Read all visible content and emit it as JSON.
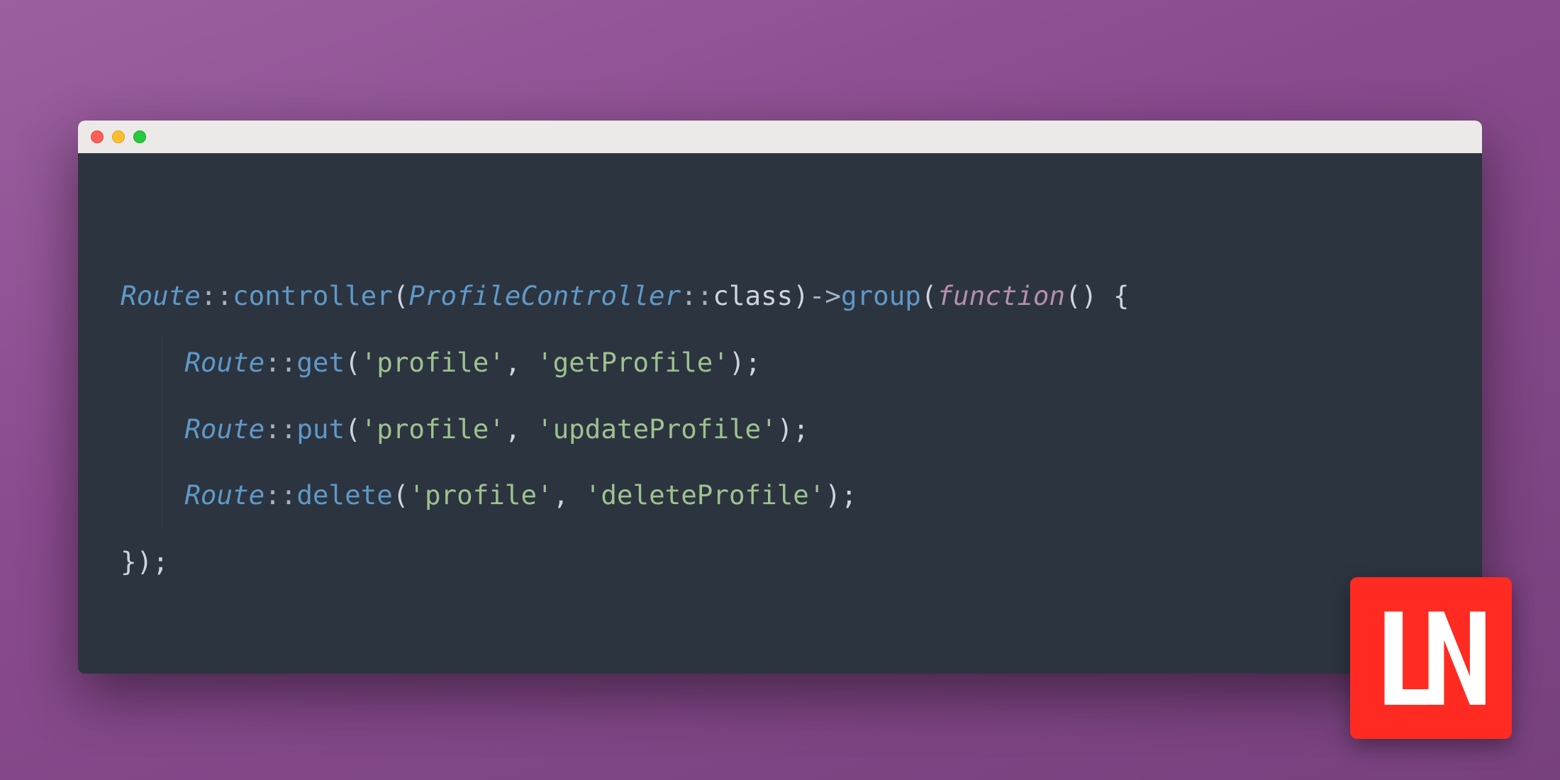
{
  "colors": {
    "background_from": "#9b5f9f",
    "background_to": "#77417d",
    "editor_bg": "#2c3440",
    "titlebar_bg": "#eceae8",
    "dot_red": "#ff5f56",
    "dot_yellow": "#ffbd2e",
    "dot_green": "#27c93f",
    "token_class": "#5f99c7",
    "token_method": "#5f99c7",
    "token_string": "#9ec28f",
    "token_fnkw": "#b48ead",
    "token_plain": "#cfd4e0",
    "token_scope": "#a6b2c1",
    "logo_bg": "#ff2b22"
  },
  "window_controls": {
    "close": "close-icon",
    "minimize": "minimize-icon",
    "zoom": "zoom-icon"
  },
  "logo": {
    "name": "LN",
    "semantic": "laravel-news-logo"
  },
  "code": {
    "language": "php",
    "lines": [
      {
        "indent": 0,
        "tokens": [
          {
            "t": "class",
            "v": "Route"
          },
          {
            "t": "scope",
            "v": "::"
          },
          {
            "t": "method",
            "v": "controller"
          },
          {
            "t": "paren",
            "v": "("
          },
          {
            "t": "class",
            "v": "ProfileController"
          },
          {
            "t": "scope",
            "v": "::"
          },
          {
            "t": "kwclass",
            "v": "class"
          },
          {
            "t": "paren",
            "v": ")"
          },
          {
            "t": "arrow",
            "v": "->"
          },
          {
            "t": "method",
            "v": "group"
          },
          {
            "t": "paren",
            "v": "("
          },
          {
            "t": "fnkw",
            "v": "function"
          },
          {
            "t": "paren",
            "v": "()"
          },
          {
            "t": "plain",
            "v": " {"
          }
        ]
      },
      {
        "indent": 1,
        "tokens": [
          {
            "t": "class",
            "v": "Route"
          },
          {
            "t": "scope",
            "v": "::"
          },
          {
            "t": "method",
            "v": "get"
          },
          {
            "t": "paren",
            "v": "("
          },
          {
            "t": "string",
            "v": "'profile'"
          },
          {
            "t": "plain",
            "v": ", "
          },
          {
            "t": "string",
            "v": "'getProfile'"
          },
          {
            "t": "paren",
            "v": ")"
          },
          {
            "t": "plain",
            "v": ";"
          }
        ]
      },
      {
        "indent": 1,
        "tokens": [
          {
            "t": "class",
            "v": "Route"
          },
          {
            "t": "scope",
            "v": "::"
          },
          {
            "t": "method",
            "v": "put"
          },
          {
            "t": "paren",
            "v": "("
          },
          {
            "t": "string",
            "v": "'profile'"
          },
          {
            "t": "plain",
            "v": ", "
          },
          {
            "t": "string",
            "v": "'updateProfile'"
          },
          {
            "t": "paren",
            "v": ")"
          },
          {
            "t": "plain",
            "v": ";"
          }
        ]
      },
      {
        "indent": 1,
        "tokens": [
          {
            "t": "class",
            "v": "Route"
          },
          {
            "t": "scope",
            "v": "::"
          },
          {
            "t": "method",
            "v": "delete"
          },
          {
            "t": "paren",
            "v": "("
          },
          {
            "t": "string",
            "v": "'profile'"
          },
          {
            "t": "plain",
            "v": ", "
          },
          {
            "t": "string",
            "v": "'deleteProfile'"
          },
          {
            "t": "paren",
            "v": ")"
          },
          {
            "t": "plain",
            "v": ";"
          }
        ]
      },
      {
        "indent": 0,
        "tokens": [
          {
            "t": "plain",
            "v": "});"
          }
        ]
      }
    ]
  }
}
